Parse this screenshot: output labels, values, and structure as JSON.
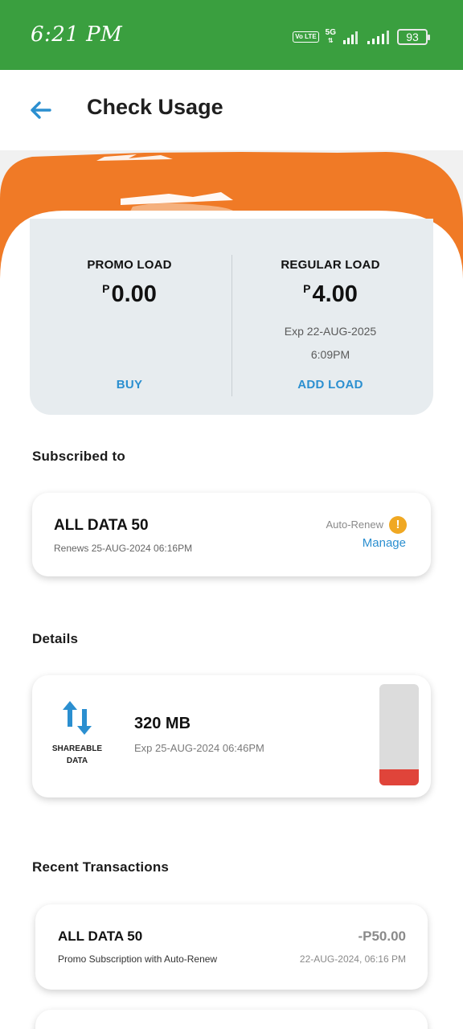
{
  "status_bar": {
    "time": "6:21 PM",
    "volte": "Vo LTE",
    "network": "5G",
    "battery": "93"
  },
  "header": {
    "back_icon": "arrow-left-icon",
    "title": "Check Usage"
  },
  "balances": {
    "promo": {
      "label": "PROMO LOAD",
      "currency": "P",
      "amount": "0.00",
      "action": "BUY"
    },
    "regular": {
      "label": "REGULAR LOAD",
      "currency": "P",
      "amount": "4.00",
      "expiry_line1": "Exp 22-AUG-2025",
      "expiry_line2": "6:09PM",
      "action": "ADD LOAD"
    }
  },
  "subscribed": {
    "section_title": "Subscribed to",
    "name": "ALL DATA 50",
    "renews": "Renews 25-AUG-2024 06:16PM",
    "auto_renew_label": "Auto-Renew",
    "warning_icon": "exclamation-icon",
    "manage_label": "Manage"
  },
  "details": {
    "section_title": "Details",
    "icon": "up-down-arrows-icon",
    "type_line1": "SHAREABLE",
    "type_line2": "DATA",
    "amount": "320 MB",
    "expiry": "Exp 25-AUG-2024 06:46PM",
    "remaining_fraction": 0.16
  },
  "transactions": {
    "section_title": "Recent Transactions",
    "items": [
      {
        "name": "ALL DATA 50",
        "description": "Promo Subscription with Auto-Renew",
        "amount": "-P50.00",
        "date": "22-AUG-2024, 06:16 PM"
      }
    ]
  },
  "colors": {
    "status_bar": "#3a9f3f",
    "accent_orange": "#f07a26",
    "link_blue": "#2b8fd0",
    "usage_red": "#e0443a",
    "warning_amber": "#f0a823"
  }
}
